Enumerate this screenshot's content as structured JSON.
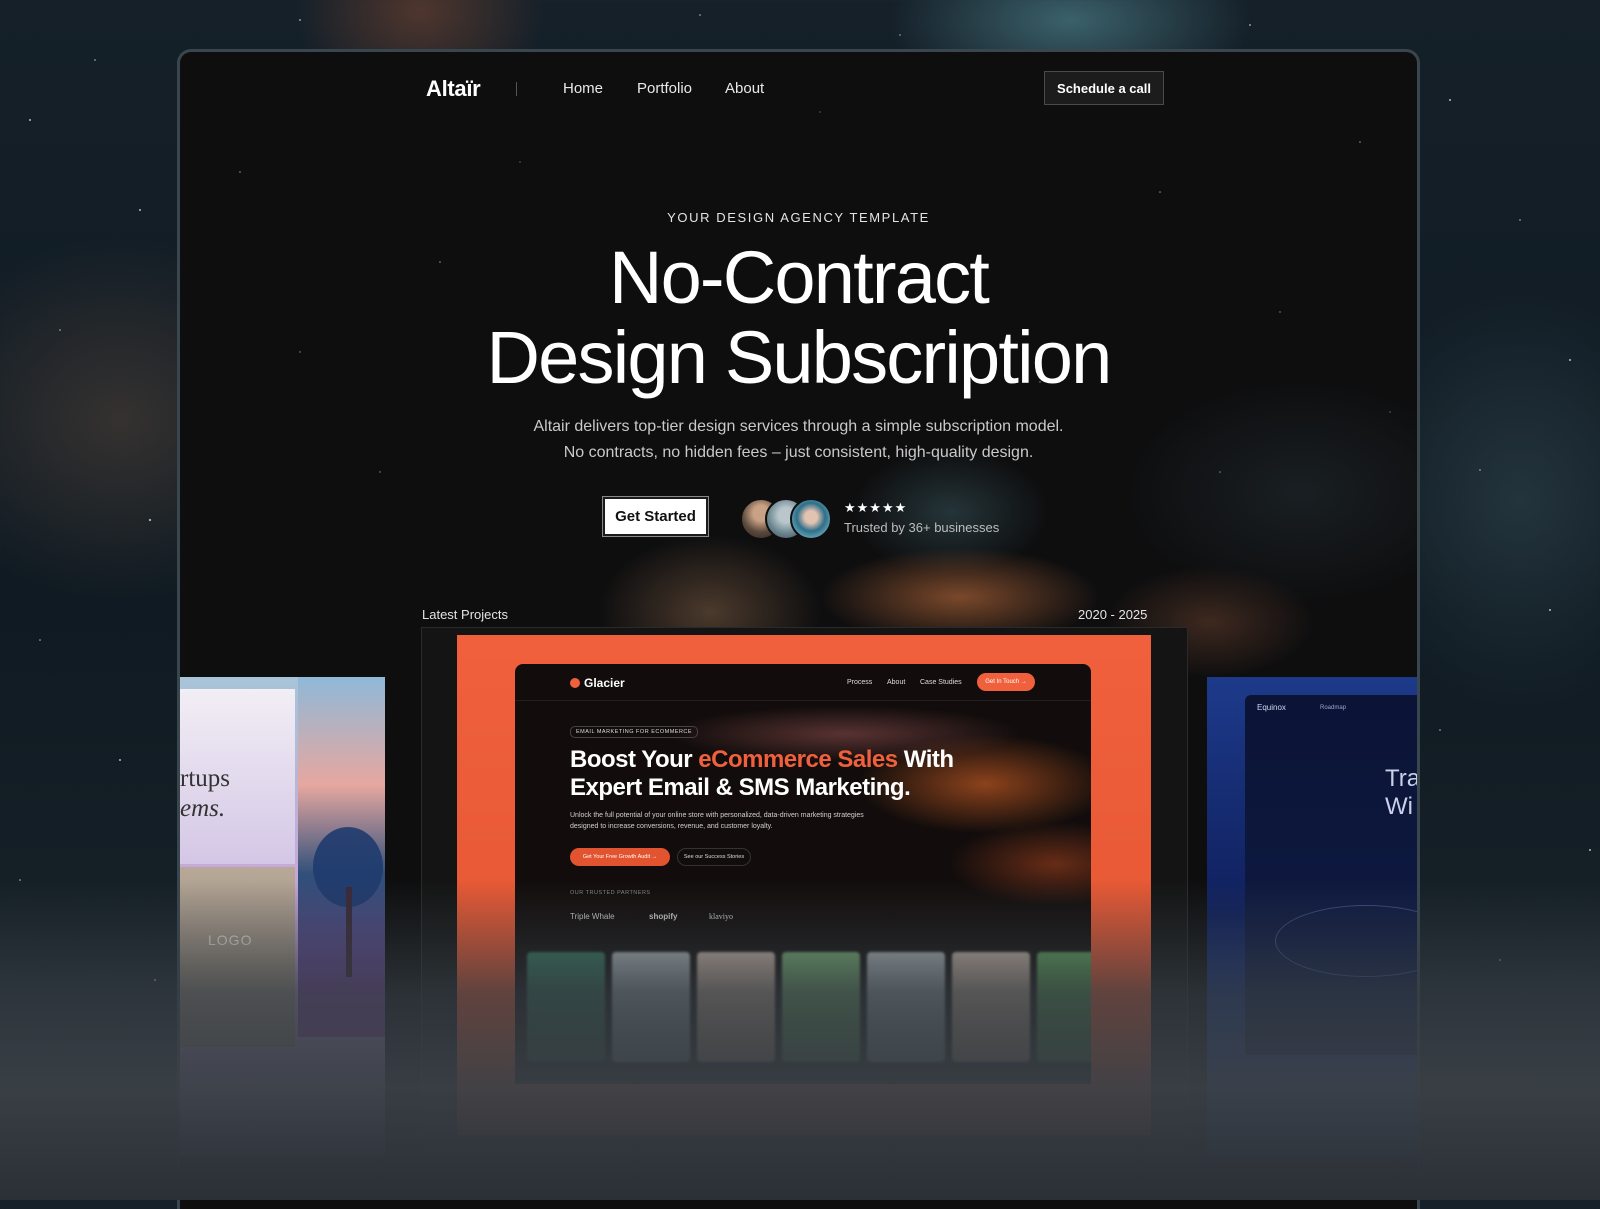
{
  "nav": {
    "logo": "Altaïr",
    "links": [
      "Home",
      "Portfolio",
      "About"
    ],
    "cta": "Schedule a call"
  },
  "hero": {
    "eyebrow": "YOUR DESIGN AGENCY TEMPLATE",
    "title_line1": "No-Contract",
    "title_line2": "Design Subscription",
    "subtitle_line1": "Altair delivers top-tier design services through a simple subscription model.",
    "subtitle_line2": "No contracts, no hidden fees – just consistent, high-quality design.",
    "primary_button": "Get Started",
    "rating": "★★★★★",
    "trusted_text": "Trusted by 36+ businesses"
  },
  "projects": {
    "label": "Latest Projects",
    "years": "2020 - 2025",
    "featured": {
      "logo": "Glacier",
      "nav": [
        "Process",
        "About",
        "Case Studies"
      ],
      "nav_cta": "Get In Touch →",
      "tag": "EMAIL MARKETING FOR ECOMMERCE",
      "headline_pre": "Boost Your ",
      "headline_highlight": "eCommerce Sales",
      "headline_post": " With Expert Email & SMS Marketing.",
      "body": "Unlock the full potential of your online store with personalized, data-driven marketing strategies designed to increase conversions, revenue, and customer loyalty.",
      "button_primary": "Get Your Free Growth Audit →",
      "button_secondary": "See our Success Stories",
      "partners_label": "OUR TRUSTED PARTNERS",
      "partners": [
        "Triple Whale",
        "shopify",
        "klaviyo"
      ],
      "accent": "#f0603c"
    },
    "left_preview": {
      "text_line1": "rtups",
      "text_line2": "ems.",
      "badge": "LOGO"
    },
    "right_preview": {
      "brand": "Equinox",
      "nav": "Roadmap",
      "text_line1": "Tra",
      "text_line2": "Wi"
    }
  }
}
